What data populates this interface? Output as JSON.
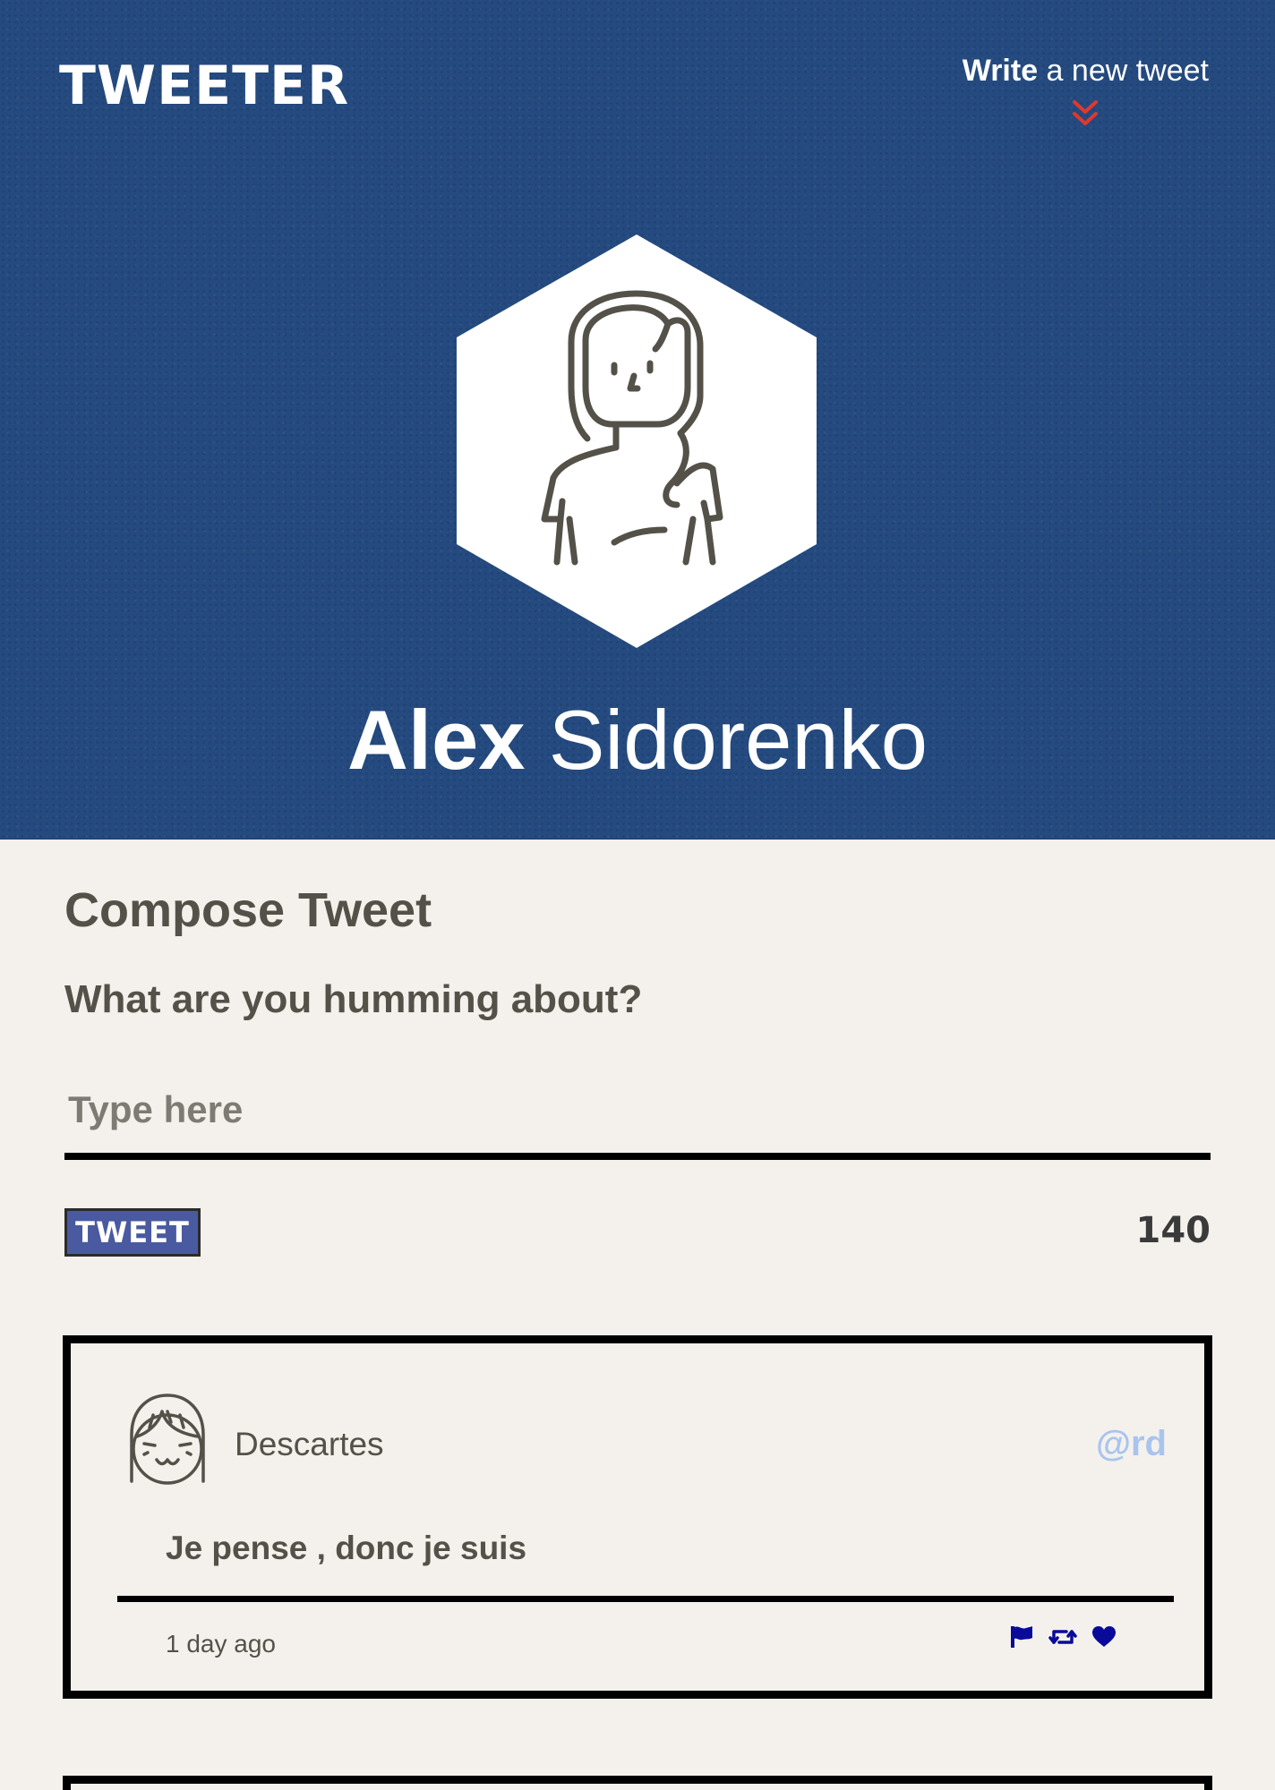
{
  "header": {
    "logo": "TWEETER",
    "write_bold": "Write",
    "write_rest": " a new tweet",
    "chevron_icon": "double-chevron-down-icon",
    "chevron_color": "#e0382e",
    "background_color": "#244a7f"
  },
  "profile": {
    "first_name": "Alex",
    "last_name": " Sidorenko",
    "avatar_icon": "woman-avatar-icon"
  },
  "compose": {
    "title": "Compose Tweet",
    "question": "What are you humming about?",
    "placeholder": "Type here",
    "value": "",
    "button_label": "TWEET",
    "counter": "140"
  },
  "tweets": [
    {
      "name": "Descartes",
      "handle": "@rd",
      "content": "Je pense , donc je suis",
      "time": "1 day ago",
      "avatar_icon": "girl-avatar-icon",
      "actions": [
        "flag-icon",
        "retweet-icon",
        "heart-icon"
      ],
      "action_color": "#0a0a9a"
    }
  ]
}
